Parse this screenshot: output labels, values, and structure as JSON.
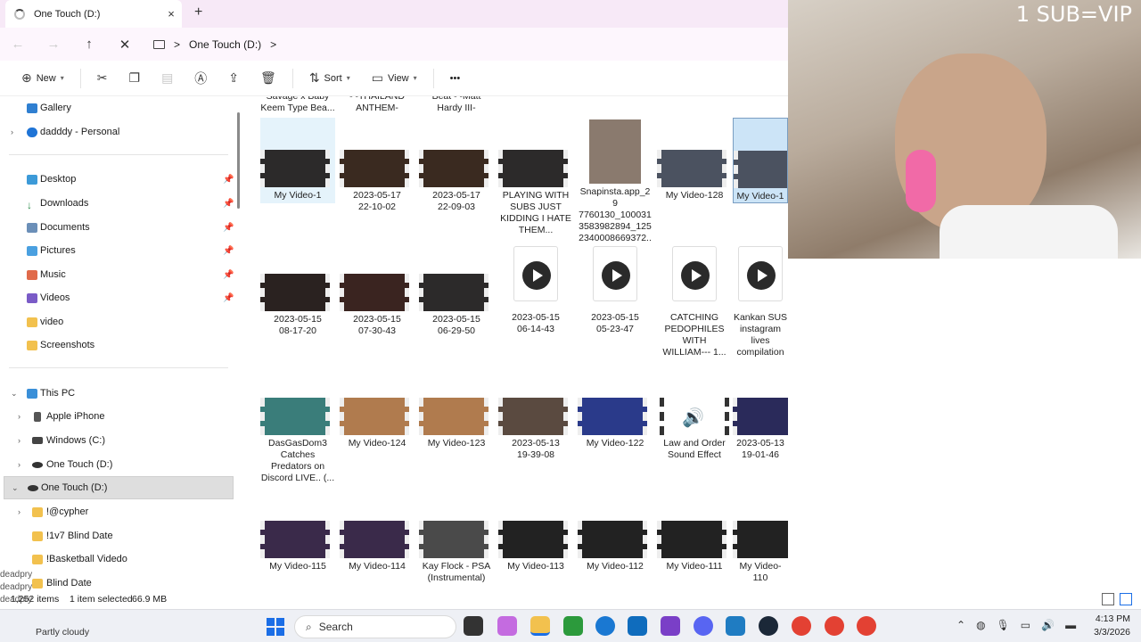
{
  "window": {
    "tab_title": "One Touch (D:)",
    "new_tab_label": "+",
    "close_label": "×"
  },
  "address": {
    "crumb": "One Touch (D:)",
    "separator": ">"
  },
  "toolbar": {
    "new_label": "New",
    "sort_label": "Sort",
    "view_label": "View",
    "more_label": "•••"
  },
  "sidebar": {
    "items": [
      {
        "label": "Gallery"
      },
      {
        "label": "dadddy - Personal"
      },
      {
        "label": "Desktop"
      },
      {
        "label": "Downloads"
      },
      {
        "label": "Documents"
      },
      {
        "label": "Pictures"
      },
      {
        "label": "Music"
      },
      {
        "label": "Videos"
      },
      {
        "label": "video"
      },
      {
        "label": "Screenshots"
      },
      {
        "label": "This PC"
      },
      {
        "label": "Apple iPhone"
      },
      {
        "label": "Windows (C:)"
      },
      {
        "label": "One Touch (D:)"
      },
      {
        "label": "One Touch (D:)"
      },
      {
        "label": "!@cypher"
      },
      {
        "label": "!1v7 Blind Date"
      },
      {
        "label": "!Basketball Videdo"
      },
      {
        "label": "Blind Date"
      }
    ]
  },
  "top_partial": [
    "Savage x Baby\nKeem Type Bea...",
    "- -THAILAND\nANTHEM-",
    "Beat - -Matt\nHardy III-"
  ],
  "files": [
    {
      "name": "My Video-1"
    },
    {
      "name": "2023-05-17\n22-10-02"
    },
    {
      "name": "2023-05-17\n22-09-03"
    },
    {
      "name": "PLAYING WITH\nSUBS JUST\nKIDDING I HATE\nTHEM..."
    },
    {
      "name": "Snapinsta.app_29\n7760130_100031\n3583982894_125\n2340008669372..."
    },
    {
      "name": "My Video-128"
    },
    {
      "name": "My Video-1"
    },
    {
      "name": "2023-05-15\n08-17-20"
    },
    {
      "name": "2023-05-15\n07-30-43"
    },
    {
      "name": "2023-05-15\n06-29-50"
    },
    {
      "name": "2023-05-15\n06-14-43"
    },
    {
      "name": "2023-05-15\n05-23-47"
    },
    {
      "name": "CATCHING\nPEDOPHILES\nWITH\nWILLIAM--- 1..."
    },
    {
      "name": "Kankan SUS\ninstagram lives\ncompilation"
    },
    {
      "name": "DasGasDom3\nCatches\nPredators on\nDiscord LIVE.. (..."
    },
    {
      "name": "My Video-124"
    },
    {
      "name": "My Video-123"
    },
    {
      "name": "2023-05-13\n19-39-08"
    },
    {
      "name": "My Video-122"
    },
    {
      "name": "Law and Order\nSound Effect"
    },
    {
      "name": "2023-05-13\n19-01-46"
    },
    {
      "name": "My Video-115"
    },
    {
      "name": "My Video-114"
    },
    {
      "name": "Kay Flock - PSA\n(Instrumental)"
    },
    {
      "name": "My Video-113"
    },
    {
      "name": "My Video-112"
    },
    {
      "name": "My Video-111"
    },
    {
      "name": "My Video-110"
    }
  ],
  "status": {
    "count": "1,252 items",
    "selected": "1 item selected",
    "size": "66.9 MB"
  },
  "taskbar": {
    "weather": "Partly cloudy",
    "search": "Search",
    "time": "4:13 PM",
    "date": "3/3/2026"
  },
  "overlay": {
    "webcam_text": "1 SUB=VIP",
    "chat_name": "deadpry"
  },
  "colors": {
    "selection": "#cce4f7",
    "titlebar": "#f7e9f7",
    "accent": "#1b6ee6"
  }
}
